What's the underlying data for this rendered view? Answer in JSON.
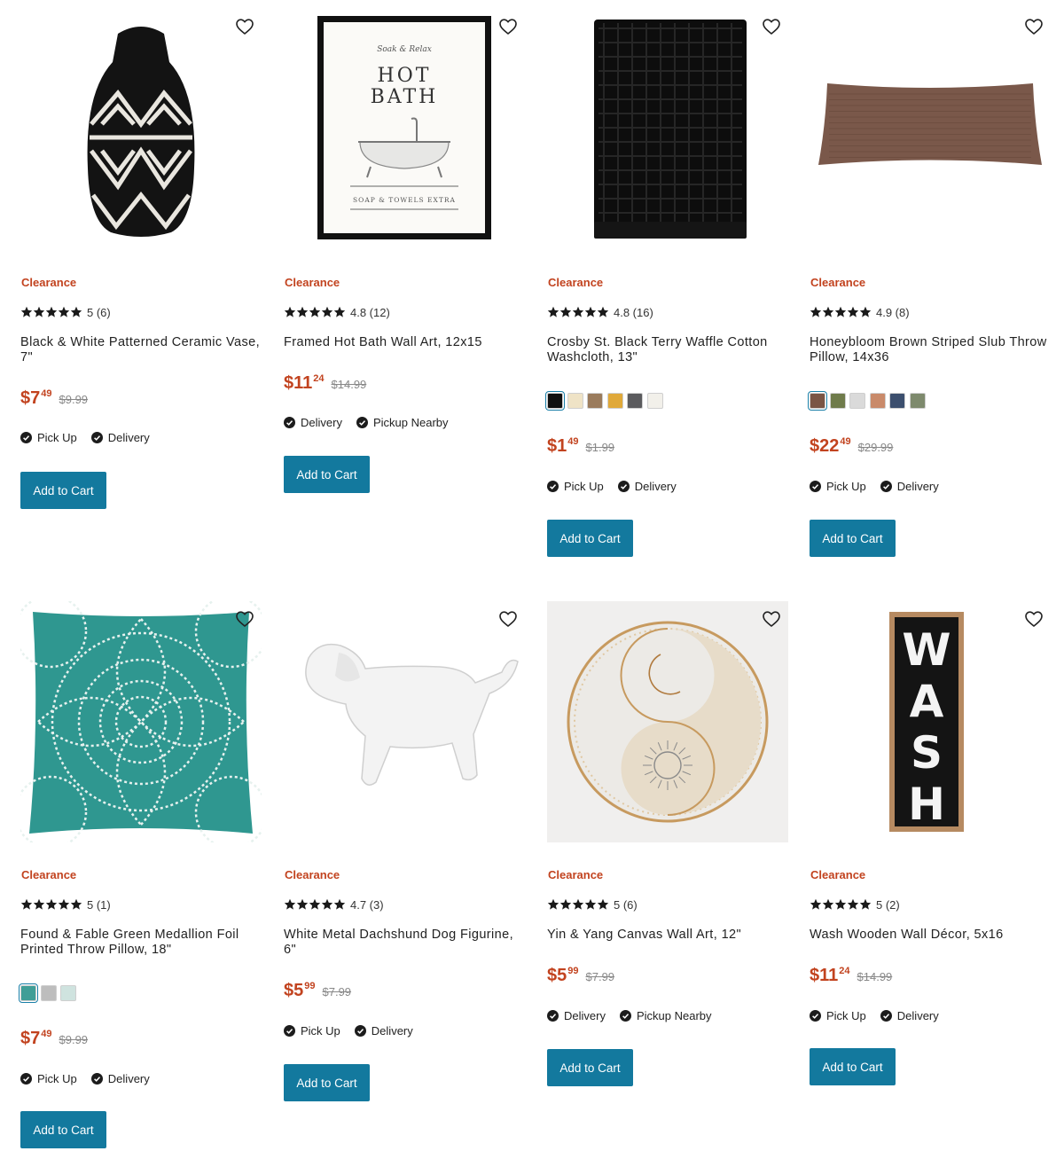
{
  "icons": {
    "heart": "heart-outline-icon",
    "star": "star-icon",
    "check": "check-circle-icon"
  },
  "colors": {
    "clearance": "#c2431f",
    "button": "#13799e",
    "price": "#c2431f"
  },
  "products": [
    {
      "tag": "Clearance",
      "rating": "5 (6)",
      "title": "Black & White Patterned Ceramic Vase, 7\"",
      "price_dollars": "$7",
      "price_cents": "49",
      "price_was": "$9.99",
      "fulfillment": [
        "Pick Up",
        "Delivery"
      ],
      "swatches": [],
      "button": "Add to Cart"
    },
    {
      "tag": "Clearance",
      "rating": "4.8 (12)",
      "title": "Framed Hot Bath Wall Art, 12x15",
      "price_dollars": "$11",
      "price_cents": "24",
      "price_was": "$14.99",
      "fulfillment": [
        "Delivery",
        "Pickup Nearby"
      ],
      "swatches": [],
      "button": "Add to Cart",
      "art": {
        "script": "Soak & Relax",
        "line1": "HOT",
        "line2": "BATH",
        "footer": "SOAP & TOWELS EXTRA"
      }
    },
    {
      "tag": "Clearance",
      "rating": "4.8 (16)",
      "title": "Crosby St. Black Terry Waffle Cotton Washcloth, 13\"",
      "price_dollars": "$1",
      "price_cents": "49",
      "price_was": "$1.99",
      "fulfillment": [
        "Pick Up",
        "Delivery"
      ],
      "swatches": [
        "#111111",
        "#efe3c6",
        "#9a7b5c",
        "#e0a93a",
        "#5b5b5e",
        "#f2f0ea"
      ],
      "button": "Add to Cart"
    },
    {
      "tag": "Clearance",
      "rating": "4.9 (8)",
      "title": "Honeybloom Brown Striped Slub Throw Pillow, 14x36",
      "price_dollars": "$22",
      "price_cents": "49",
      "price_was": "$29.99",
      "fulfillment": [
        "Pick Up",
        "Delivery"
      ],
      "swatches": [
        "#7a5545",
        "#6f7b4b",
        "#dadada",
        "#c98a6a",
        "#3c4f6e",
        "#7e8a6d"
      ],
      "button": "Add to Cart"
    },
    {
      "tag": "Clearance",
      "rating": "5 (1)",
      "title": "Found & Fable Green Medallion Foil Printed Throw Pillow, 18\"",
      "price_dollars": "$7",
      "price_cents": "49",
      "price_was": "$9.99",
      "fulfillment": [
        "Pick Up",
        "Delivery"
      ],
      "swatches": [
        "#3f9e97",
        "#bdbdbd",
        "#cfe3df"
      ],
      "button": "Add to Cart"
    },
    {
      "tag": "Clearance",
      "rating": "4.7 (3)",
      "title": "White Metal Dachshund Dog Figurine, 6\"",
      "price_dollars": "$5",
      "price_cents": "99",
      "price_was": "$7.99",
      "fulfillment": [
        "Pick Up",
        "Delivery"
      ],
      "swatches": [],
      "button": "Add to Cart"
    },
    {
      "tag": "Clearance",
      "rating": "5 (6)",
      "title": "Yin & Yang Canvas Wall Art, 12\"",
      "price_dollars": "$5",
      "price_cents": "99",
      "price_was": "$7.99",
      "fulfillment": [
        "Delivery",
        "Pickup Nearby"
      ],
      "swatches": [],
      "button": "Add to Cart"
    },
    {
      "tag": "Clearance",
      "rating": "5 (2)",
      "title": "Wash Wooden Wall Décor, 5x16",
      "price_dollars": "$11",
      "price_cents": "24",
      "price_was": "$14.99",
      "fulfillment": [
        "Pick Up",
        "Delivery"
      ],
      "swatches": [],
      "button": "Add to Cart",
      "art": {
        "word": "WASH"
      }
    }
  ]
}
